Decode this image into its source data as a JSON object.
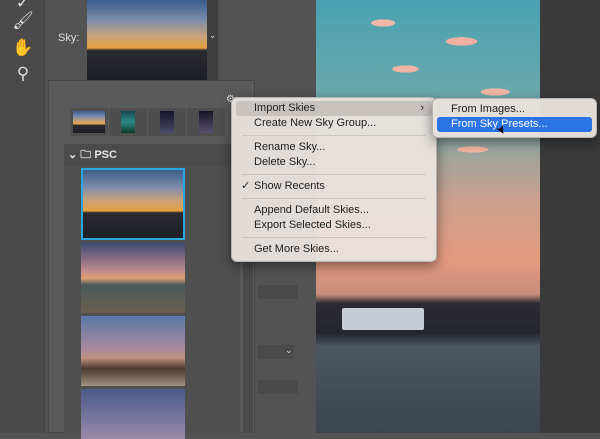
{
  "panel": {
    "sky_label": "Sky:",
    "group_name": "PSC"
  },
  "context_menu": {
    "items": [
      {
        "label": "Import Skies",
        "submenu": true,
        "highlighted": true
      },
      {
        "label": "Create New Sky Group..."
      },
      {
        "label": "Rename Sky..."
      },
      {
        "label": "Delete Sky..."
      },
      {
        "label": "Show Recents",
        "checked": true
      },
      {
        "label": "Append Default Skies..."
      },
      {
        "label": "Export Selected Skies..."
      },
      {
        "label": "Get More Skies..."
      }
    ],
    "check_mark": "✓",
    "submenu_arrow": "›"
  },
  "submenu": {
    "items": [
      {
        "label": "From Images..."
      },
      {
        "label": "From Sky Presets...",
        "selected": true
      }
    ]
  },
  "colors": {
    "selection_accent": "#2a74e6",
    "thumb_border": "#29a8e0"
  }
}
